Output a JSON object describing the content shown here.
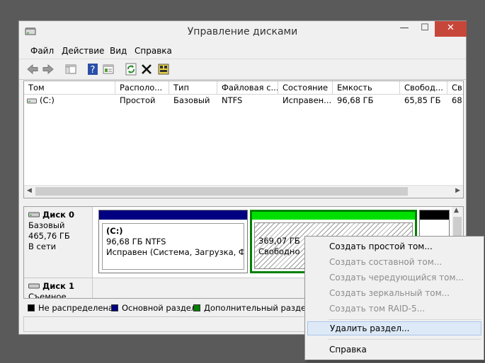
{
  "window": {
    "title": "Управление дисками",
    "controls": {
      "minimize": "—",
      "maximize": "☐",
      "close": "✕"
    }
  },
  "menu": [
    "Файл",
    "Действие",
    "Вид",
    "Справка"
  ],
  "toolbar": {
    "icons": [
      "back-arrow-icon",
      "forward-arrow-icon",
      "console-tree-icon",
      "help-icon",
      "properties-icon",
      "refresh-icon",
      "delete-icon",
      "settings-icon"
    ]
  },
  "volume_list": {
    "columns": [
      "Том",
      "Располо...",
      "Тип",
      "Файловая с...",
      "Состояние",
      "Емкость",
      "Свобод...",
      "Св"
    ],
    "rows": [
      {
        "volume": "(C:)",
        "layout": "Простой",
        "type": "Базовый",
        "fs": "NTFS",
        "status": "Исправен...",
        "capacity": "96,68 ГБ",
        "free": "65,85 ГБ",
        "free_pct": "68"
      }
    ]
  },
  "disks": [
    {
      "name": "Диск 0",
      "type": "Базовый",
      "size": "465,76 ГБ",
      "state": "В сети",
      "partitions": [
        {
          "label": "(C:)",
          "size_fs": "96,68 ГБ NTFS",
          "status": "Исправен (Система, Загрузка, Файл"
        },
        {
          "size": "369,07 ГБ",
          "status": "Свободно"
        }
      ]
    },
    {
      "name": "Диск 1",
      "type": "Съемное устро"
    }
  ],
  "legend": [
    {
      "label": "Не распределена",
      "color": "#000000"
    },
    {
      "label": "Основной раздел",
      "color": "#000080"
    },
    {
      "label": "Дополнительный раздел",
      "color": "#008000"
    }
  ],
  "context_menu": {
    "items": [
      {
        "label": "Создать простой том...",
        "enabled": true
      },
      {
        "label": "Создать составной том...",
        "enabled": false
      },
      {
        "label": "Создать чередующийся том...",
        "enabled": false
      },
      {
        "label": "Создать зеркальный том...",
        "enabled": false
      },
      {
        "label": "Создать том RAID-5...",
        "enabled": false
      },
      {
        "label": "Удалить раздел...",
        "enabled": true,
        "highlighted": true
      },
      {
        "label": "Справка",
        "enabled": true
      }
    ]
  },
  "colors": {
    "primary": "#000080",
    "extended": "#00c000",
    "close_button": "#c7463a",
    "highlight": "#dde9f7"
  }
}
